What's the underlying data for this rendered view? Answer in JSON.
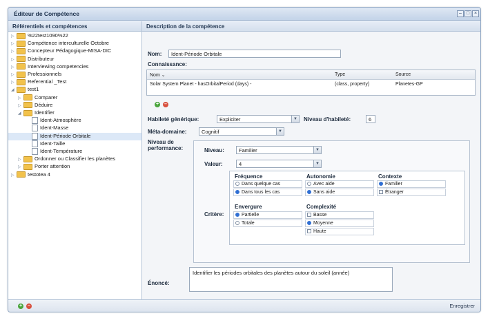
{
  "window": {
    "title": "Éditeur de Compétence"
  },
  "left_panel": {
    "header": "Référentiels et compétences",
    "tree": [
      {
        "label": "%22test1090%22",
        "type": "folder",
        "expander": "▷"
      },
      {
        "label": "Compétence interculturelle Octobre",
        "type": "folder",
        "expander": "▷"
      },
      {
        "label": "Concepteur Pédagogique-MISA-DIC",
        "type": "folder",
        "expander": "▷"
      },
      {
        "label": "Distributeur",
        "type": "folder",
        "expander": "▷"
      },
      {
        "label": "Interviewing competencies",
        "type": "folder",
        "expander": "▷"
      },
      {
        "label": "Professionnels",
        "type": "folder",
        "expander": "▷"
      },
      {
        "label": "Referential _Test",
        "type": "folder",
        "expander": "▷"
      },
      {
        "label": "test1",
        "type": "folder",
        "expander": "◢"
      },
      {
        "label": "Comparer",
        "type": "folder",
        "expander": "▷"
      },
      {
        "label": "Déduire",
        "type": "folder",
        "expander": "▷"
      },
      {
        "label": "Identifier",
        "type": "folder",
        "expander": "◢"
      },
      {
        "label": "Ident-Atmosphère",
        "type": "doc"
      },
      {
        "label": "Ident-Masse",
        "type": "doc"
      },
      {
        "label": "Ident-Période Orbitale",
        "type": "doc",
        "selected": true
      },
      {
        "label": "Ident-Taille",
        "type": "doc"
      },
      {
        "label": "Ident-Température",
        "type": "doc"
      },
      {
        "label": "Ordonner ou Classifier les planètes",
        "type": "folder",
        "expander": "▷"
      },
      {
        "label": "Porter attention",
        "type": "folder",
        "expander": "▷"
      },
      {
        "label": "testotea 4",
        "type": "folder",
        "expander": "▷"
      }
    ]
  },
  "right_panel": {
    "header": "Description de la compétence",
    "nom_label": "Nom:",
    "nom_value": "Ident-Période Orbitale",
    "connaissance_label": "Connaissance:",
    "grid": {
      "headers": [
        "Nom ⌄",
        "Type",
        "Source"
      ],
      "rows": [
        [
          "Solar System Planet - hasOrbitalPeriod (days) -",
          "(class, property)",
          "Planetes-GP"
        ]
      ]
    },
    "habilete_label": "Habileté générique:",
    "habilete_value": "Expliciter",
    "niveau_habilete_label": "Niveau d'habileté:",
    "niveau_habilete_value": "6",
    "meta_label": "Méta-domaine:",
    "meta_value": "Cognitif",
    "perf_label": "Niveau de performance:",
    "niveau_label": "Niveau:",
    "niveau_value": "Familier",
    "valeur_label": "Valeur:",
    "valeur_value": "4",
    "critere_label": "Critère:",
    "frequence": {
      "title": "Fréquence",
      "options": [
        "Dans quelque cas",
        "Dans tous les cas"
      ]
    },
    "autonomie": {
      "title": "Autonomie",
      "options": [
        "Avec aide",
        "Sans aide"
      ]
    },
    "contexte": {
      "title": "Contexte",
      "options": [
        "Familier",
        "Étranger"
      ]
    },
    "envergure": {
      "title": "Envergure",
      "options": [
        "Partielle",
        "Totale"
      ]
    },
    "complexite": {
      "title": "Complexité",
      "options": [
        "Basse",
        "Moyenne",
        "Haute"
      ]
    },
    "enonce_label": "Énoncé:",
    "enonce_value": "Identifier les périodes orbitales des planètes autour du soleil (année)"
  },
  "footer": {
    "save_label": "Enregistrer"
  }
}
